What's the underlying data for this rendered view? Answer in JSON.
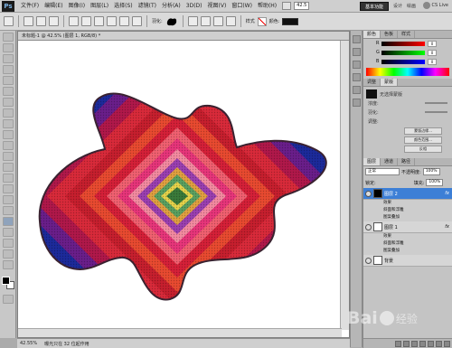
{
  "menubar": {
    "logo": "Ps",
    "items": [
      "文件(F)",
      "编辑(E)",
      "图像(I)",
      "图层(L)",
      "选择(S)",
      "滤镜(T)",
      "分析(A)",
      "3D(D)",
      "视图(V)",
      "窗口(W)",
      "帮助(H)"
    ],
    "zoom": "42.5",
    "workspace_active": "基本功能",
    "workspace_design": "设计",
    "workspace_paint": "绘画",
    "cs_live": "CS Live"
  },
  "options": {
    "feather_label": "羽化:",
    "style_label": "样式",
    "color_label": "颜色:"
  },
  "document": {
    "tab": "未标题-1 @ 42.5% (图层 1, RGB/8) *",
    "status_zoom": "42.55%",
    "status_info": "曝光只在 32 位起作用"
  },
  "color_panel": {
    "tabs": [
      "颜色",
      "色板",
      "样式"
    ],
    "channels": [
      {
        "letter": "R",
        "value": "0"
      },
      {
        "letter": "G",
        "value": "0"
      },
      {
        "letter": "B",
        "value": "0"
      }
    ]
  },
  "adjust_panel": {
    "tabs": [
      "调整",
      "蒙版"
    ],
    "title": "无选择蒙版",
    "rows": [
      "浓度:",
      "羽化:",
      "调整:"
    ],
    "buttons": [
      "蒙版边缘...",
      "颜色范围...",
      "反相"
    ]
  },
  "layers_panel": {
    "tabs": [
      "图层",
      "通道",
      "路径"
    ],
    "blend_mode": "正常",
    "opacity_label": "不透明度:",
    "opacity": "100%",
    "lock_label": "锁定:",
    "fill_label": "填充:",
    "fill": "100%",
    "layers": [
      {
        "name": "图层 2",
        "active": true,
        "fx": "fx",
        "dark": true
      },
      {
        "name": "效果",
        "sub": true
      },
      {
        "name": "斜面和浮雕",
        "sub": true
      },
      {
        "name": "图案叠加",
        "sub": true
      },
      {
        "name": "图层 1",
        "active": false,
        "fx": "fx",
        "dark": false
      },
      {
        "name": "效果",
        "sub": true
      },
      {
        "name": "斜面和浮雕",
        "sub": true
      },
      {
        "name": "图案叠加",
        "sub": true
      },
      {
        "name": "背景",
        "active": false,
        "fx": "",
        "dark": false
      }
    ]
  },
  "watermark": {
    "text": "Bai",
    "text2": "经验"
  }
}
